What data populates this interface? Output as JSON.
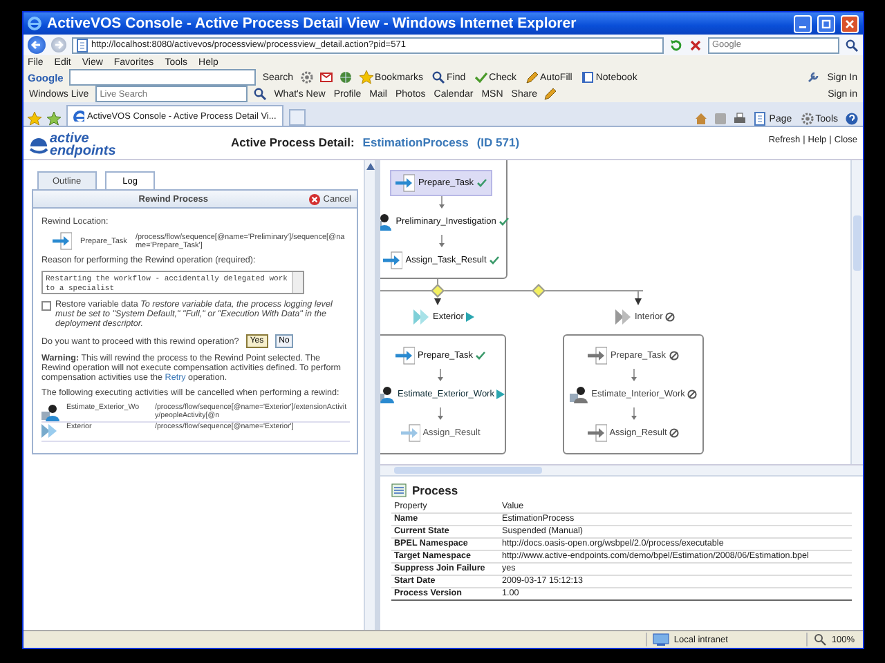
{
  "window": {
    "title": "ActiveVOS Console - Active Process Detail View - Windows Internet Explorer"
  },
  "address_bar": {
    "url": "http://localhost:8080/activevos/processview/processview_detail.action?pid=571",
    "search_placeholder": "Google"
  },
  "menu": [
    "File",
    "Edit",
    "View",
    "Favorites",
    "Tools",
    "Help"
  ],
  "google_toolbar": {
    "logo": "Google",
    "search_button": "Search",
    "items": [
      "Bookmarks",
      "Find",
      "Check",
      "AutoFill",
      "Notebook"
    ],
    "sign_in": "Sign In"
  },
  "live_toolbar": {
    "label": "Windows Live",
    "search_placeholder": "Live Search",
    "links": [
      "What's New",
      "Profile",
      "Mail",
      "Photos",
      "Calendar",
      "MSN",
      "Share"
    ],
    "sign_in": "Sign in"
  },
  "browser_tabs": [
    {
      "label": "ActiveVOS Console - Active Process Detail Vi...",
      "selected": true
    }
  ],
  "command_bar": [
    "Page",
    "Tools"
  ],
  "page_header": {
    "logo_top": "active",
    "logo_bottom": "endpoints",
    "title_label": "Active Process Detail:",
    "process_name": "EstimationProcess",
    "process_id": "(ID 571)",
    "links": [
      "Refresh",
      "Help",
      "Close"
    ],
    "separator": "|"
  },
  "left_panel": {
    "tabs": [
      {
        "label": "Outline",
        "selected": false
      },
      {
        "label": "Log",
        "selected": true
      }
    ],
    "rewind": {
      "title": "Rewind Process",
      "cancel": "Cancel",
      "location_label": "Rewind Location:",
      "location": {
        "kind": "invoke",
        "name": "Prepare_Task",
        "path": "/process/flow/sequence[@name='Preliminary']/sequence[@name='Prepare_Task']"
      },
      "reason_label": "Reason for performing the Rewind operation (required):",
      "reason_value": "Restarting the workflow - accidentally delegated work to a specialist",
      "restore": {
        "checked": false,
        "text": "Restore variable data *To restore variable data, the process logging level must be set to \"System Default,\" \"Full,\" or \"Execution With Data\" in the deployment descriptor.*"
      },
      "confirm_question": "Do you want to proceed with this rewind operation?",
      "yes": "Yes",
      "no": "No",
      "warning_before": "**Warning:** This will rewind the process to the Rewind Point selected. The Rewind operation will not execute compensation activities defined. To perform compensation activities use the",
      "warning_link": "Retry",
      "warning_after": "operation.",
      "cancel_note": "The following executing activities will be cancelled when performing a rewind:",
      "cancelled": [
        {
          "kind": "person",
          "name": "Estimate_Exterior_Wo",
          "path": "/process/flow/sequence[@name='Exterior']/extensionActivity/peopleActivity[@n"
        },
        {
          "kind": "flow",
          "name": "Exterior",
          "path": "/process/flow/sequence[@name='Exterior']"
        }
      ]
    }
  },
  "diagram": {
    "top_sequence": [
      {
        "kind": "invoke",
        "label": "Prepare_Task",
        "completed": true,
        "running": false,
        "skipped": false,
        "selected": true
      },
      {
        "kind": "person",
        "label": "Preliminary_Investigation",
        "completed": true,
        "running": false,
        "skipped": false,
        "selected": false
      },
      {
        "kind": "invoke",
        "label": "Assign_Task_Result",
        "completed": true,
        "running": false,
        "skipped": false,
        "selected": false
      }
    ],
    "branches": [
      {
        "label": "Exterior",
        "running": true,
        "skipped": false,
        "activities": [
          {
            "kind": "invoke",
            "label": "Prepare_Task",
            "completed": true,
            "running": false,
            "skipped": false,
            "selected": false
          },
          {
            "kind": "person",
            "label": "Estimate_Exterior_Work",
            "completed": false,
            "running": true,
            "skipped": false,
            "selected": false
          },
          {
            "kind": "invoke",
            "label": "Assign_Result",
            "completed": false,
            "running": false,
            "skipped": false,
            "selected": false
          }
        ]
      },
      {
        "label": "Interior",
        "running": false,
        "skipped": true,
        "activities": [
          {
            "kind": "invoke",
            "label": "Prepare_Task",
            "completed": false,
            "running": false,
            "skipped": true,
            "selected": false
          },
          {
            "kind": "person",
            "label": "Estimate_Interior_Work",
            "completed": false,
            "running": false,
            "skipped": true,
            "selected": false
          },
          {
            "kind": "invoke",
            "label": "Assign_Result",
            "completed": false,
            "running": false,
            "skipped": true,
            "selected": false
          }
        ]
      }
    ]
  },
  "process": {
    "title": "Process",
    "columns": [
      "Property",
      "Value"
    ],
    "rows": [
      [
        "Name",
        "EstimationProcess"
      ],
      [
        "Current State",
        "Suspended (Manual)"
      ],
      [
        "BPEL Namespace",
        "http://docs.oasis-open.org/wsbpel/2.0/process/executable"
      ],
      [
        "Target Namespace",
        "http://www.active-endpoints.com/demo/bpel/Estimation/2008/06/Estimation.bpel"
      ],
      [
        "Suppress Join Failure",
        "yes"
      ],
      [
        "Start Date",
        "2009-03-17 15:12:13"
      ],
      [
        "Process Version",
        "1.00"
      ]
    ]
  },
  "status_bar": {
    "zone": "Local intranet",
    "zoom": "100%"
  }
}
